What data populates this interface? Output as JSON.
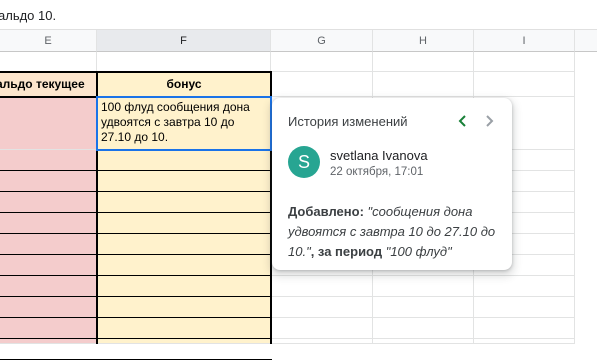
{
  "formula_bar": {
    "text": "альдо 10."
  },
  "columns": [
    {
      "letter": "E"
    },
    {
      "letter": "F"
    },
    {
      "letter": "G"
    },
    {
      "letter": "H"
    },
    {
      "letter": "I"
    }
  ],
  "header_row": {
    "e_label": "альдо текущее",
    "f_label": "бонус"
  },
  "selected_cell": {
    "text_line1": "100 флуд сообщения дона",
    "text_line2": "удвоятся с завтра 10 до",
    "text_line3": "27.10 до 10."
  },
  "colors": {
    "e_fill": "#f4cccc",
    "f_fill": "#fff2cc",
    "selection": "#1a73e8",
    "avatar": "#27a592",
    "nav_active": "#188038"
  },
  "popup": {
    "title": "История изменений",
    "prev_icon": "chevron-left-icon",
    "next_icon": "chevron-right-icon",
    "avatar_letter": "S",
    "author": "svetlana Ivanova",
    "timestamp": "22 октября, 17:01",
    "added_label": "Добавлено",
    "added_colon": ": ",
    "added_value": "\"сообщения дона удвоятся с завтра 10 до 27.10 до 10.\"",
    "period_label": ", за период ",
    "period_value": "\"100 флуд\""
  }
}
